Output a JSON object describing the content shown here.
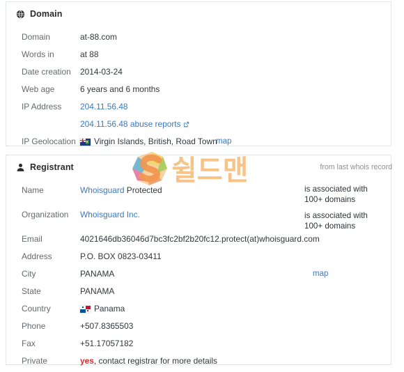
{
  "domain_section": {
    "title": "Domain",
    "icon": "globe-icon",
    "rows": [
      {
        "label": "Domain",
        "value": "at-88.com"
      },
      {
        "label": "Words in",
        "value": "at 88"
      },
      {
        "label": "Date creation",
        "value": "2014-03-24"
      },
      {
        "label": "Web age",
        "value": "6 years and 6 months"
      },
      {
        "label": "IP Address",
        "value": "204.11.56.48"
      },
      {
        "label": "",
        "value": "204.11.56.48 abuse reports",
        "icon": "external-link-icon"
      },
      {
        "label": "IP Geolocation",
        "value": "Virgin Islands, British, Road Town",
        "flag": "bvi-flag-icon",
        "map_label": "map"
      }
    ]
  },
  "registrant_section": {
    "title": "Registrant",
    "icon": "user-icon",
    "source_note": "from last whois record",
    "rows": [
      {
        "label": "Name",
        "value_link": "Whoisguard",
        "value_soft": "Protected",
        "note": "is associated with 100+ domains"
      },
      {
        "label": "Organization",
        "value_link": "Whoisguard Inc.",
        "note": "is associated with 100+ domains"
      },
      {
        "label": "Email",
        "value": "4021646db36046d7bc3fc2bf2b20fc12.protect(at)whoisguard.com"
      },
      {
        "label": "Address",
        "value": "P.O. BOX 0823-03411"
      },
      {
        "label": "City",
        "value": "PANAMA",
        "map_label": "map"
      },
      {
        "label": "State",
        "value": "PANAMA"
      },
      {
        "label": "Country",
        "value": "Panama",
        "flag": "panama-flag-icon"
      },
      {
        "label": "Phone",
        "value": "+507.8365503"
      },
      {
        "label": "Fax",
        "value": "+51.17057182"
      },
      {
        "label": "Private",
        "value_emphasis": "yes",
        "value_rest": ", contact registrar for more details"
      }
    ]
  },
  "watermark": {
    "text": "쉴드맨",
    "logo": "shieldman-s-logo",
    "text_color": "#f6c389",
    "logo_colors": [
      "#f0d35a",
      "#e8743c",
      "#8cc63f",
      "#3aa6d8",
      "#d94f9a",
      "#f4a23c"
    ]
  },
  "colors": {
    "link": "#3a79bd",
    "link_soft": "#7ea6ce",
    "label": "#66696b",
    "value": "#33373a",
    "muted": "#8d9093",
    "danger": "#e02a2a",
    "card_border": "#e3e6e8",
    "background": "#ffffff"
  }
}
